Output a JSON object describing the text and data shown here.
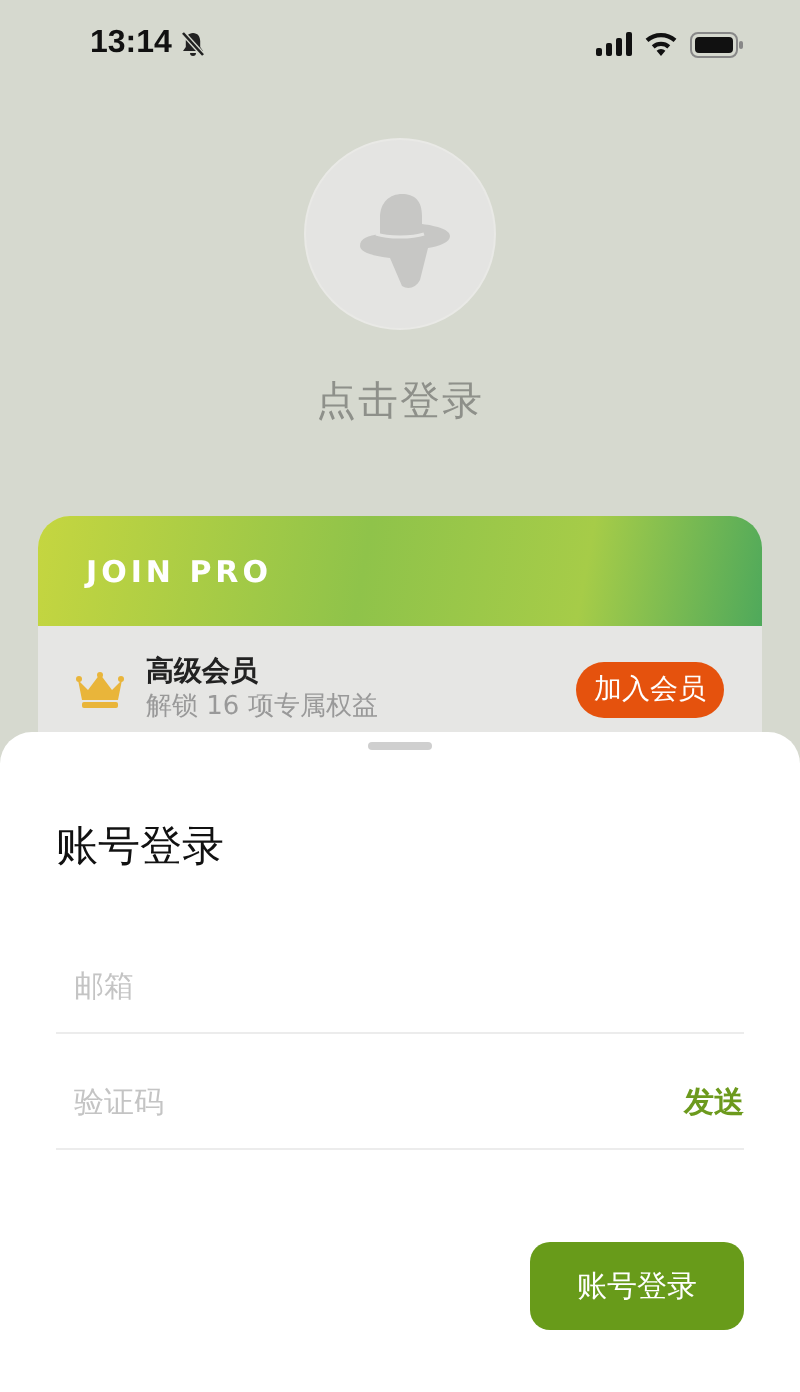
{
  "status_bar": {
    "time": "13:14"
  },
  "profile": {
    "login_prompt": "点击登录"
  },
  "pro_card": {
    "banner": "JOIN PRO",
    "title": "高级会员",
    "subtitle": "解锁 16 项专属权益",
    "button": "加入会员"
  },
  "login_sheet": {
    "title": "账号登录",
    "fields": [
      {
        "placeholder": "邮箱"
      },
      {
        "placeholder": "验证码",
        "action": "发送"
      }
    ],
    "submit": "账号登录"
  }
}
